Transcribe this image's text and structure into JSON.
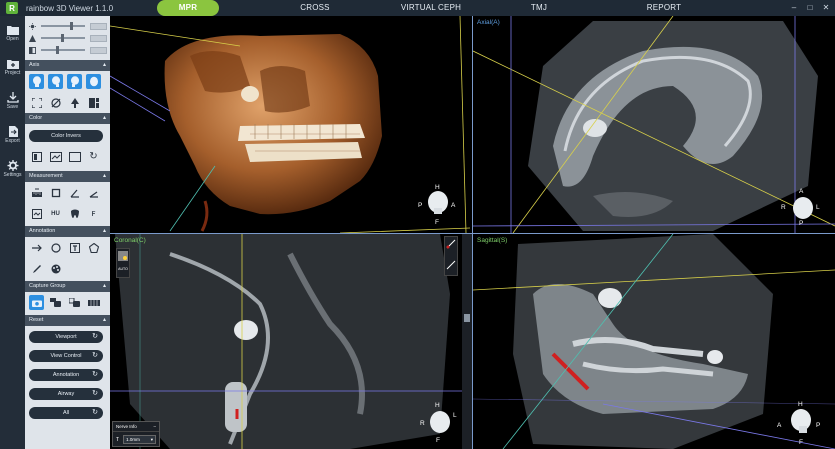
{
  "app": {
    "logo": "R",
    "title": "rainbow 3D Viewer 1.1.0"
  },
  "tabs": [
    {
      "label": "MPR",
      "active": true
    },
    {
      "label": "CROSS",
      "active": false
    },
    {
      "label": "VIRTUAL CEPH",
      "active": false
    },
    {
      "label": "TMJ",
      "active": false
    },
    {
      "label": "REPORT",
      "active": false
    }
  ],
  "window_controls": {
    "minimize": "–",
    "maximize": "□",
    "close": "✕"
  },
  "leftnav": [
    {
      "label": "Open",
      "icon": "folder-icon"
    },
    {
      "label": "Project",
      "icon": "project-folder-icon"
    },
    {
      "label": "Save",
      "icon": "save-icon"
    },
    {
      "label": "Export",
      "icon": "export-icon"
    },
    {
      "label": "Settings",
      "icon": "gear-icon"
    }
  ],
  "panel": {
    "sliders": [
      {
        "icon": "brightness-icon",
        "level": 0.65
      },
      {
        "icon": "contrast-icon",
        "level": 0.45
      },
      {
        "icon": "opacity-icon",
        "level": 0.35
      }
    ],
    "sections": {
      "axis": "Axis",
      "color": "Color",
      "measurement": "Measurement",
      "annotation": "Annotation",
      "capture_group": "Capture Group",
      "reset": "Reset"
    },
    "color_invert_label": "Color Invers",
    "hu_label": "HU",
    "auto_label": "AUTO",
    "reset_buttons": [
      "Viewport",
      "View Control",
      "Annotation",
      "Airway",
      "All"
    ]
  },
  "viewports": {
    "axial": {
      "label": "Axial(A)"
    },
    "coronal": {
      "label": "Coronal(C)"
    },
    "sagittal": {
      "label": "Sagittal(S)"
    }
  },
  "orientation_letters": {
    "head": "H",
    "foot": "F",
    "anterior": "A",
    "posterior": "P",
    "right": "R",
    "left": "L"
  },
  "nerve_info": {
    "title": "Nerve Info",
    "thickness_label": "T",
    "thickness_value": "1.0mm"
  },
  "colors": {
    "accent_green": "#8bc53f",
    "axis_blue": "#2d8fe0",
    "crosshair_yellow": "#d8d04a",
    "crosshair_blue": "#7a78e8",
    "nerve_red": "#d02020"
  }
}
